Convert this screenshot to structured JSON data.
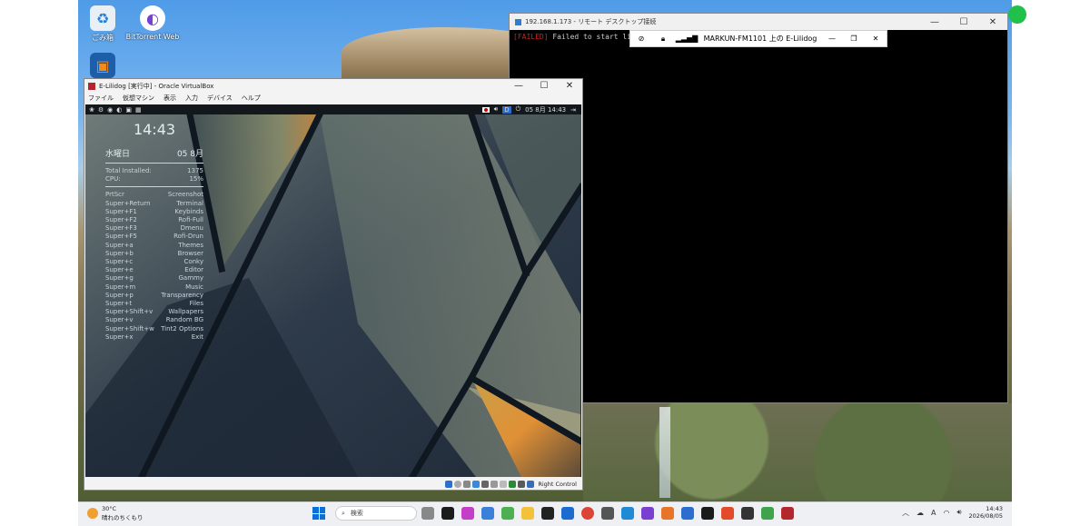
{
  "desktop": {
    "icons": [
      {
        "name": "recycle-bin",
        "label": "ごみ箱"
      },
      {
        "name": "bittorrent-web",
        "label": "BitTorrent Web"
      },
      {
        "name": "virtualbox",
        "label": ""
      }
    ]
  },
  "rdp": {
    "title": "192.168.1.173 - リモート デスクトップ接続",
    "terminal_tag": "[FAILED]",
    "terminal_text": " Failed to start light",
    "bar_label": "MARKUN-FM1101 上の E-Lilidog"
  },
  "vbox": {
    "title": "E-Lilidog [実行中] - Oracle VirtualBox",
    "menu": [
      "ファイル",
      "仮想マシン",
      "表示",
      "入力",
      "デバイス",
      "ヘルプ"
    ],
    "panel_date": "05 8月 14:43",
    "status_right": "Right Control"
  },
  "conky": {
    "clock": "14:43",
    "weekday": "水曜日",
    "date": "05 8月",
    "stats": [
      {
        "label": "Total Installed:",
        "value": "1375"
      },
      {
        "label": "CPU:",
        "value": "15%"
      }
    ],
    "shortcuts": [
      {
        "key": "PrtScr",
        "action": "Screenshot"
      },
      {
        "key": "Super+Return",
        "action": "Terminal"
      },
      {
        "key": "Super+F1",
        "action": "Keybinds"
      },
      {
        "key": "Super+F2",
        "action": "Rofi-Full"
      },
      {
        "key": "Super+F3",
        "action": "Dmenu"
      },
      {
        "key": "Super+F5",
        "action": "Rofi-Drun"
      },
      {
        "key": "Super+a",
        "action": "Themes"
      },
      {
        "key": "Super+b",
        "action": "Browser"
      },
      {
        "key": "Super+c",
        "action": "Conky"
      },
      {
        "key": "Super+e",
        "action": "Editor"
      },
      {
        "key": "Super+g",
        "action": "Gammy"
      },
      {
        "key": "Super+m",
        "action": "Music"
      },
      {
        "key": "Super+p",
        "action": "Transparency"
      },
      {
        "key": "Super+t",
        "action": "Files"
      },
      {
        "key": "Super+Shift+v",
        "action": "Wallpapers"
      },
      {
        "key": "Super+v",
        "action": "Random BG"
      },
      {
        "key": "Super+Shift+w",
        "action": "Tint2 Options"
      },
      {
        "key": "Super+x",
        "action": "Exit"
      }
    ]
  },
  "taskbar": {
    "temp": "30°C",
    "weather": "晴れのちくもり",
    "search_placeholder": "検索",
    "time": "14:43",
    "date": "2026/08/05",
    "ime": "A"
  }
}
